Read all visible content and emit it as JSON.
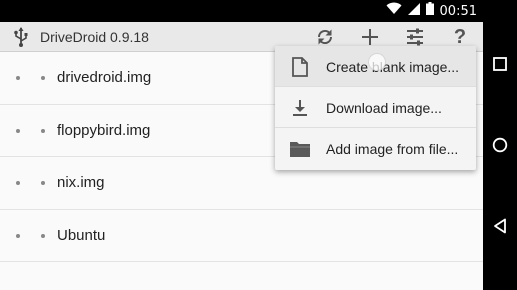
{
  "status_bar": {
    "time": "00:51",
    "icons": [
      "wifi-icon",
      "cell-signal-icon",
      "battery-icon"
    ]
  },
  "action_bar": {
    "app_icon": "usb-icon",
    "title": "DriveDroid 0.9.18",
    "actions": [
      {
        "name": "refresh-icon"
      },
      {
        "name": "add-icon"
      },
      {
        "name": "settings-sliders-icon"
      },
      {
        "name": "help-icon",
        "glyph": "?"
      }
    ]
  },
  "images": [
    {
      "label": "drivedroid.img"
    },
    {
      "label": "floppybird.img"
    },
    {
      "label": "nix.img"
    },
    {
      "label": "Ubuntu"
    }
  ],
  "menu": {
    "items": [
      {
        "label": "Create blank image...",
        "icon": "blank-file-icon"
      },
      {
        "label": "Download image...",
        "icon": "download-icon"
      },
      {
        "label": "Add image from file...",
        "icon": "folder-icon"
      }
    ]
  },
  "nav_bar": {
    "buttons": [
      "recents-button",
      "home-button",
      "back-button"
    ]
  },
  "colors": {
    "action_bar_bg": "#e9e9e9",
    "background": "#fafafa",
    "menu_bg": "#f4f4f4"
  }
}
